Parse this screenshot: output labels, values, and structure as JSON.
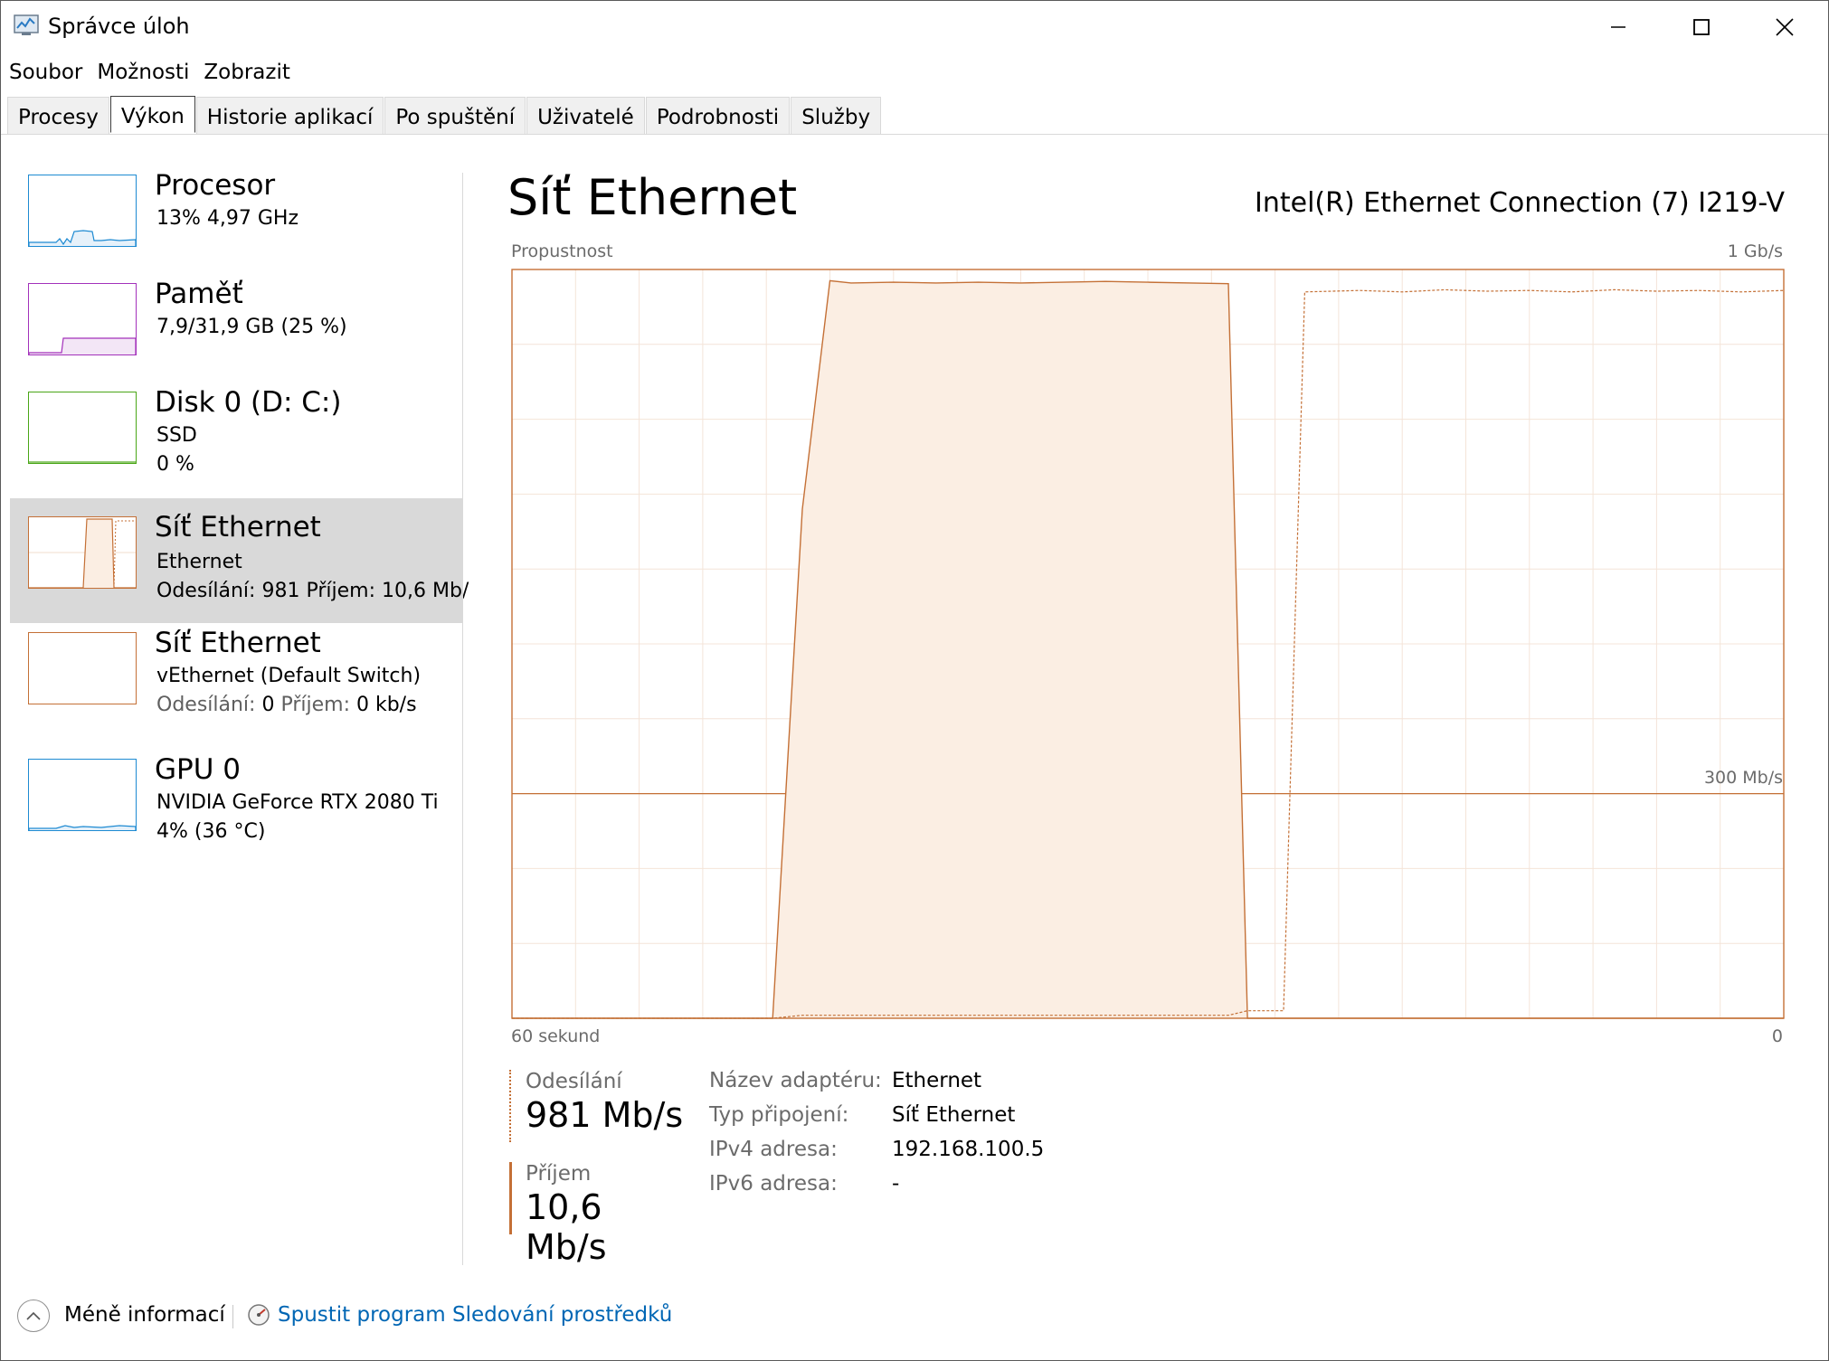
{
  "window": {
    "title": "Správce úloh",
    "controls": {
      "minimize": "—",
      "maximize": "☐",
      "close": "✕"
    }
  },
  "menu": {
    "file": "Soubor",
    "options": "Možnosti",
    "view": "Zobrazit"
  },
  "tabs": [
    {
      "label": "Procesy"
    },
    {
      "label": "Výkon",
      "active": true
    },
    {
      "label": "Historie aplikací"
    },
    {
      "label": "Po spuštění"
    },
    {
      "label": "Uživatelé"
    },
    {
      "label": "Podrobnosti"
    },
    {
      "label": "Služby"
    }
  ],
  "sidebar": {
    "items": [
      {
        "title": "Procesor",
        "line1": "13%  4,97 GHz",
        "color": "#1d8ad2"
      },
      {
        "title": "Paměť",
        "line1": "7,9/31,9 GB (25 %)",
        "color": "#a331bb"
      },
      {
        "title": "Disk 0 (D: C:)",
        "line1": "SSD",
        "line2": "0 %",
        "color": "#4aa617"
      },
      {
        "title": "Síť Ethernet",
        "line1": "Ethernet",
        "send_label": "Odesílání:",
        "send_value": "981",
        "recv_label": "Příjem:",
        "recv_value": "10,6 Mb/",
        "color": "#c47036",
        "selected": true
      },
      {
        "title": "Síť Ethernet",
        "line1": "vEthernet (Default Switch)",
        "send_label": "Odesílání:",
        "send_value": "0",
        "recv_label": "Příjem:",
        "recv_value": "0 kb/s",
        "color": "#c47036"
      },
      {
        "title": "GPU 0",
        "line1": "NVIDIA GeForce RTX 2080 Ti",
        "line2": "4%  (36 °C)",
        "color": "#1d8ad2"
      }
    ]
  },
  "main": {
    "title": "Síť Ethernet",
    "adapter": "Intel(R) Ethernet Connection (7) I219-V"
  },
  "chart_data": {
    "type": "area",
    "title": "",
    "ylabel": "Propustnost",
    "ymax_label": "1 Gb/s",
    "ref_label": "300 Mb/s",
    "xlabel_left": "60 sekund",
    "xlabel_right": "0",
    "ylim_mbps": [
      0,
      1000
    ],
    "reference_line_mbps": 300,
    "x_seconds": [
      60,
      49.2,
      47.7,
      46.3,
      45.0,
      44.0,
      42.0,
      40.0,
      38.0,
      36.0,
      34.0,
      32.0,
      30.0,
      28.0,
      26.2,
      25.3,
      24.9,
      23.6,
      22.6,
      20.0,
      18.0,
      16.0,
      14.0,
      12.0,
      10.0,
      8.0,
      6.0,
      4.0,
      2.0,
      0
    ],
    "series": [
      {
        "name": "Odesílání",
        "style": "solid",
        "values": [
          0,
          0,
          0,
          680,
          985,
          982,
          983,
          982,
          983,
          982,
          983,
          984,
          983,
          982,
          981,
          0,
          0,
          0,
          0,
          0,
          0,
          0,
          0,
          0,
          0,
          0,
          0,
          0,
          0,
          0
        ]
      },
      {
        "name": "Příjem",
        "style": "dashed",
        "values": [
          0,
          0,
          0,
          4,
          4,
          4,
          4,
          4,
          4,
          4,
          4,
          4,
          4,
          4,
          4,
          10,
          10,
          10,
          970,
          972,
          970,
          973,
          971,
          972,
          970,
          973,
          971,
          972,
          970,
          972
        ]
      }
    ],
    "grid": true,
    "color": "#c47036",
    "fill": "#fbeee3"
  },
  "stats": {
    "send_label": "Odesílání",
    "send_value": "981 Mb/s",
    "recv_label": "Příjem",
    "recv_value": "10,6 Mb/s"
  },
  "properties": [
    {
      "label": "Název adaptéru:",
      "value": "Ethernet"
    },
    {
      "label": "Typ připojení:",
      "value": "Síť Ethernet"
    },
    {
      "label": "IPv4 adresa:",
      "value": "192.168.100.5"
    },
    {
      "label": "IPv6 adresa:",
      "value": "-"
    }
  ],
  "footer": {
    "fewer_label": "Méně informací",
    "monitor_link": "Spustit program Sledování prostředků"
  }
}
